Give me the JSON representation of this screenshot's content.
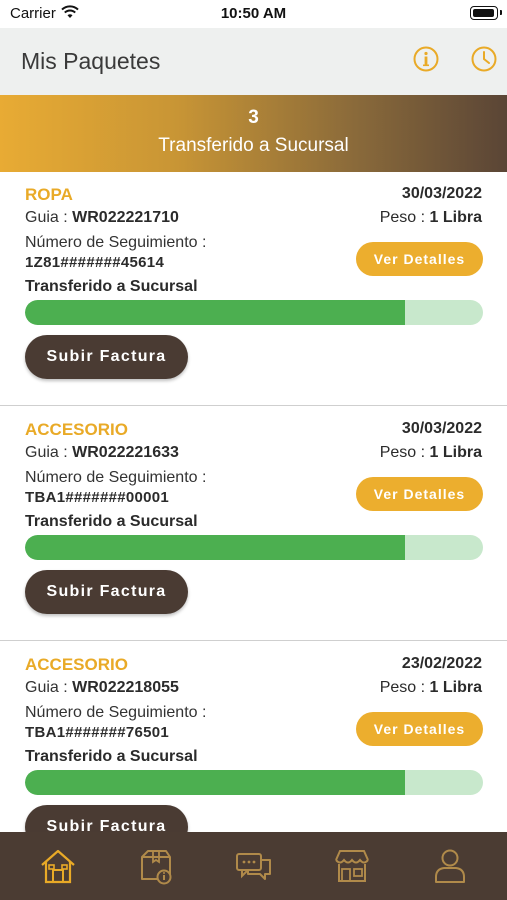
{
  "status_bar": {
    "carrier": "Carrier",
    "time": "10:50 AM"
  },
  "header": {
    "title": "Mis Paquetes",
    "icons": [
      "info-icon",
      "clock-icon"
    ]
  },
  "banner": {
    "count": "3",
    "status": "Transferido a Sucursal"
  },
  "colors": {
    "accent": "#ECAE2E",
    "dark": "#4A3B33",
    "progress": "#4CAF50",
    "progress_track": "#C8E8CC"
  },
  "packages": [
    {
      "category": "ROPA",
      "date": "30/03/2022",
      "guia_label": "Guia : ",
      "guia": "WR022221710",
      "peso_label": "Peso : ",
      "peso": "1 Libra",
      "tracking_label": "Número de Seguimiento :",
      "tracking": "1Z81#######45614",
      "details_label": "Ver Detalles",
      "status": "Transferido a Sucursal",
      "progress": 0.83,
      "upload_label": "Subir Factura"
    },
    {
      "category": "ACCESORIO",
      "date": "30/03/2022",
      "guia_label": "Guia : ",
      "guia": "WR022221633",
      "peso_label": "Peso : ",
      "peso": "1 Libra",
      "tracking_label": "Número de Seguimiento :",
      "tracking": "TBA1#######00001",
      "details_label": "Ver Detalles",
      "status": "Transferido a Sucursal",
      "progress": 0.83,
      "upload_label": "Subir Factura"
    },
    {
      "category": "ACCESORIO",
      "date": "23/02/2022",
      "guia_label": "Guia : ",
      "guia": "WR022218055",
      "peso_label": "Peso : ",
      "peso": "1 Libra",
      "tracking_label": "Número de Seguimiento :",
      "tracking": "TBA1#######76501",
      "details_label": "Ver Detalles",
      "status": "Transferido a Sucursal",
      "progress": 0.83,
      "upload_label": "Subir Factura"
    }
  ],
  "bottom_nav": [
    "home-icon",
    "package-info-icon",
    "chat-icon",
    "store-icon",
    "profile-icon"
  ]
}
